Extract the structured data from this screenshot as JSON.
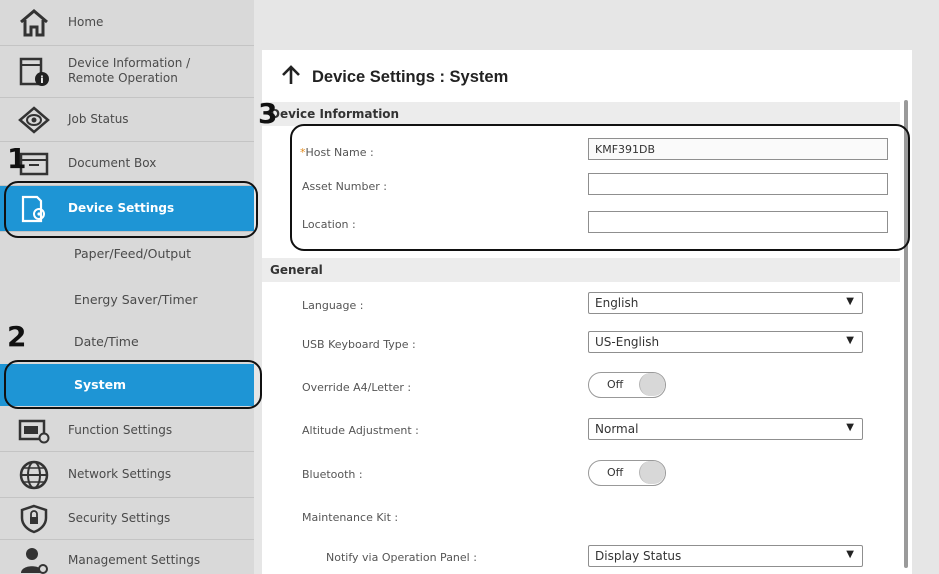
{
  "sidebar": {
    "items": [
      {
        "label": "Home",
        "icon": "home-icon"
      },
      {
        "label": "Device Information /",
        "label2": "Remote Operation",
        "icon": "device-info-icon"
      },
      {
        "label": "Job Status",
        "icon": "job-status-icon"
      },
      {
        "label": "Document Box",
        "icon": "document-box-icon"
      },
      {
        "label": "Device Settings",
        "icon": "device-settings-icon"
      },
      {
        "label": "Function Settings",
        "icon": "function-settings-icon"
      },
      {
        "label": "Network Settings",
        "icon": "network-globe-icon"
      },
      {
        "label": "Security Settings",
        "icon": "security-shield-icon"
      },
      {
        "label": "Management Settings",
        "icon": "management-user-icon"
      }
    ],
    "subitems": [
      {
        "label": "Paper/Feed/Output"
      },
      {
        "label": "Energy Saver/Timer"
      },
      {
        "label": "Date/Time"
      },
      {
        "label": "System"
      }
    ],
    "accent_color": "#1e95d5"
  },
  "callouts": {
    "one": "1",
    "two": "2",
    "three": "3"
  },
  "main": {
    "title": "Device Settings : System",
    "device_info": {
      "header": "Device Information",
      "required_mark": "*",
      "host_name_label": "Host Name :",
      "host_name_value": "KMF391DB",
      "asset_number_label": "Asset Number :",
      "asset_number_value": "",
      "location_label": "Location :",
      "location_value": ""
    },
    "general": {
      "header": "General",
      "language_label": "Language :",
      "language_value": "English",
      "usb_keyboard_label": "USB Keyboard Type :",
      "usb_keyboard_value": "US-English",
      "override_label": "Override A4/Letter :",
      "override_value": "Off",
      "altitude_label": "Altitude Adjustment :",
      "altitude_value": "Normal",
      "bluetooth_label": "Bluetooth :",
      "bluetooth_value": "Off",
      "maintenance_label": "Maintenance Kit :",
      "notify_label": "Notify via Operation Panel :",
      "notify_value": "Display Status"
    }
  }
}
